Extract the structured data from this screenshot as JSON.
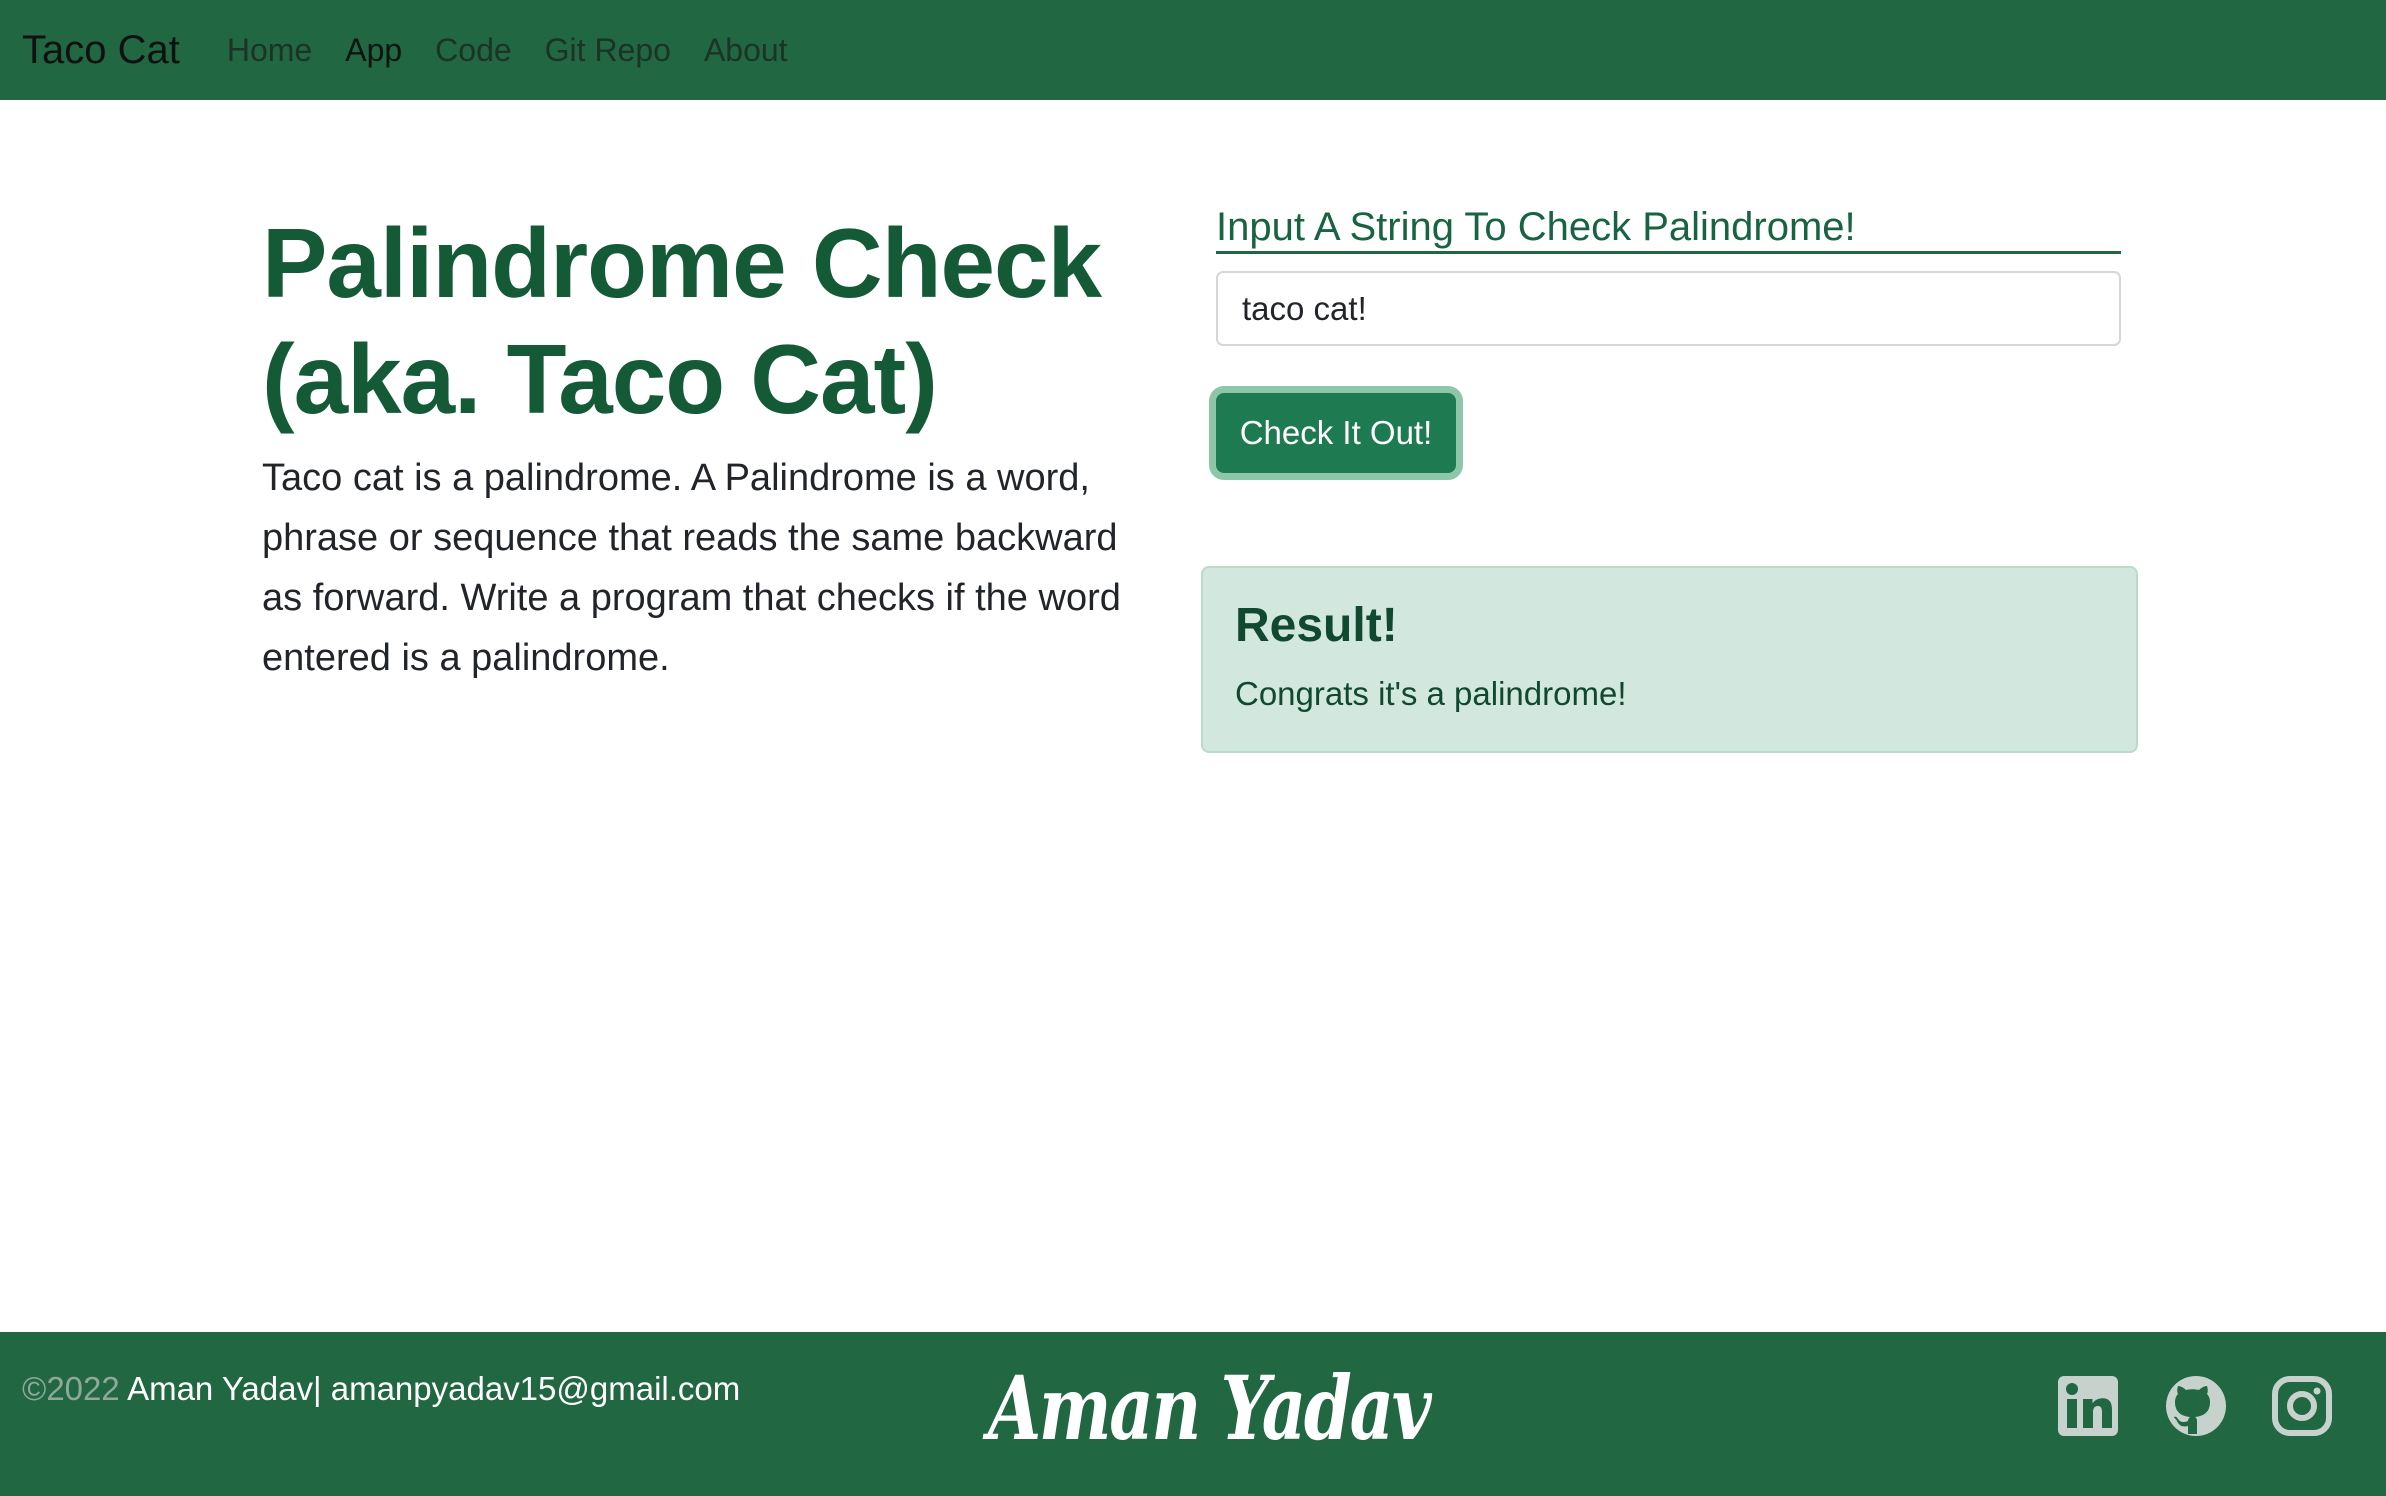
{
  "colors": {
    "nav_bg": "#216742",
    "heading": "#145a36",
    "button_bg": "#1e7a50",
    "result_bg": "#d2e7dd",
    "result_text": "#10492f"
  },
  "navbar": {
    "brand": "Taco Cat",
    "links": [
      {
        "label": "Home",
        "active": false
      },
      {
        "label": "App",
        "active": true
      },
      {
        "label": "Code",
        "active": false
      },
      {
        "label": "Git Repo",
        "active": false
      },
      {
        "label": "About",
        "active": false
      }
    ]
  },
  "main": {
    "title_line1": "Palindrome Check",
    "title_line2": "(aka. Taco Cat)",
    "description": "Taco cat is a palindrome. A Palindrome is a word, phrase or sequence that reads the same backward as forward. Write a program that checks if the word entered is a palindrome.",
    "form": {
      "label": "Input A String To Check Palindrome!",
      "input_value": "taco cat!",
      "button_label": "Check It Out!"
    },
    "result": {
      "title": "Result!",
      "message": "Congrats it's a palindrome!"
    }
  },
  "footer": {
    "year": "©2022",
    "author": " Aman Yadav| amanpyadav15@gmail.com",
    "logo_text": "Aman Yadav",
    "social_icons": [
      "linkedin-icon",
      "github-icon",
      "instagram-icon"
    ]
  }
}
